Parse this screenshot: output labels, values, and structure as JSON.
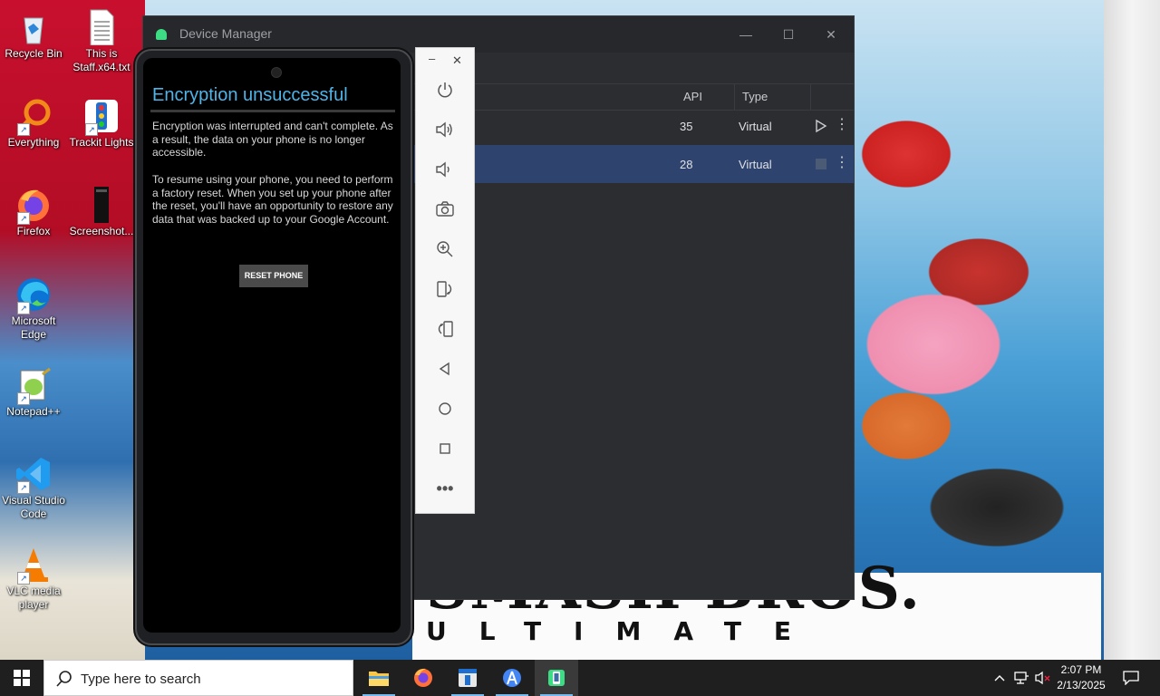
{
  "desktop": {
    "icons": [
      {
        "label": "Recycle Bin"
      },
      {
        "label": "This is Staff.x64.txt"
      },
      {
        "label": "Everything"
      },
      {
        "label": "Trackit Lights"
      },
      {
        "label": "Firefox"
      },
      {
        "label": "Screenshot..."
      },
      {
        "label": "Microsoft Edge"
      },
      {
        "label": "Notepad++"
      },
      {
        "label": "Visual Studio Code"
      },
      {
        "label": "VLC media player"
      }
    ]
  },
  "device_manager": {
    "title": "Device Manager",
    "columns": {
      "api": "API",
      "type": "Type"
    },
    "rows": [
      {
        "api": "35",
        "type": "Virtual",
        "action": "play-icon"
      },
      {
        "api": "28",
        "type": "Virtual",
        "action": "stop-icon"
      }
    ]
  },
  "emulator": {
    "screen": {
      "title": "Encryption unsuccessful",
      "paragraph1": "Encryption was interrupted and can't complete. As a result, the data on your phone is no longer accessible.",
      "paragraph2": "To resume using your phone, you need to perform a factory reset. When you set up your phone after the reset, you'll have an opportunity to restore any data that was backed up to your Google Account.",
      "reset_button": "RESET PHONE"
    },
    "toolbar": [
      "power-icon",
      "volume-up-icon",
      "volume-down-icon",
      "camera-icon",
      "zoom-icon",
      "rotate-left-icon",
      "rotate-right-icon",
      "back-icon",
      "home-icon",
      "overview-icon",
      "more-icon"
    ]
  },
  "wallpaper": {
    "logo_line1": "SMASH BROS.",
    "logo_line2": "ULTIMATE"
  },
  "taskbar": {
    "search_placeholder": "Type here to search",
    "apps": [
      "file-explorer-icon",
      "firefox-icon",
      "app-icon",
      "android-studio-icon",
      "device-manager-icon"
    ],
    "clock_time": "2:07 PM",
    "clock_date": "2/13/2025"
  }
}
